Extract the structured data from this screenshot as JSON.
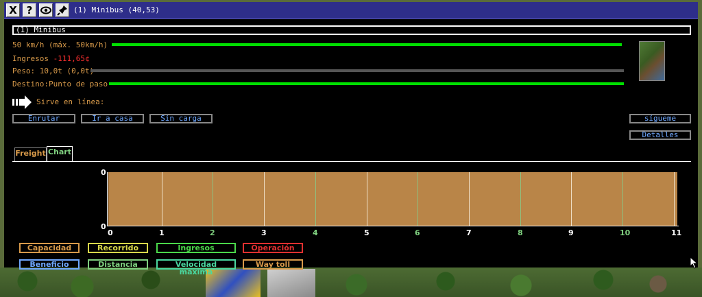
{
  "window": {
    "title": "(1) Minibus (40,53)",
    "buttons": [
      "X",
      "?",
      "👁",
      "📌"
    ],
    "vehicle_name": "(1) Minibus"
  },
  "info": {
    "speed": "50 km/h (máx. 50km/h)",
    "income_label": "Ingresos",
    "income_value": "-111,65¢",
    "weight": "Peso: 10,0t (0,0t)",
    "destination": "Destino:Punto de paso",
    "serves_line": "Sirve en línea:"
  },
  "buttons": {
    "route": "Enrutar",
    "home": "Ir a casa",
    "no_load": "Sin carga",
    "follow": "sígueme",
    "details": "Detalles"
  },
  "tabs": {
    "freight": "Freight",
    "chart": "Chart"
  },
  "chart_data": {
    "type": "line",
    "x": [
      0,
      1,
      2,
      3,
      4,
      5,
      6,
      7,
      8,
      9,
      10,
      11
    ],
    "ylim": [
      0,
      0
    ],
    "y_tick_labels": [
      "0",
      "0"
    ],
    "x_tick_colors": [
      "#ffffff",
      "#ffffff",
      "#7fd07f",
      "#ffffff",
      "#7fd07f",
      "#ffffff",
      "#7fd07f",
      "#ffffff",
      "#7fd07f",
      "#ffffff",
      "#7fd07f",
      "#ffffff"
    ],
    "series": [
      {
        "name": "Capacidad",
        "color": "#d89a4a",
        "values": [
          0,
          0,
          0,
          0,
          0,
          0,
          0,
          0,
          0,
          0,
          0,
          0
        ]
      },
      {
        "name": "Recorrido",
        "color": "#d8d84a",
        "values": [
          0,
          0,
          0,
          0,
          0,
          0,
          0,
          0,
          0,
          0,
          0,
          0
        ]
      },
      {
        "name": "Ingresos",
        "color": "#4ad84a",
        "values": [
          0,
          0,
          0,
          0,
          0,
          0,
          0,
          0,
          0,
          0,
          0,
          0
        ]
      },
      {
        "name": "Operación",
        "color": "#e03030",
        "values": [
          0,
          0,
          0,
          0,
          0,
          0,
          0,
          0,
          0,
          0,
          0,
          0
        ]
      },
      {
        "name": "Beneficio",
        "color": "#6fa8ff",
        "values": [
          0,
          0,
          0,
          0,
          0,
          0,
          0,
          0,
          0,
          0,
          0,
          0
        ]
      },
      {
        "name": "Distancia",
        "color": "#7fd07f",
        "values": [
          0,
          0,
          0,
          0,
          0,
          0,
          0,
          0,
          0,
          0,
          0,
          0
        ]
      },
      {
        "name": "Velocidad máxima",
        "color": "#4ad8a0",
        "values": [
          0,
          0,
          0,
          0,
          0,
          0,
          0,
          0,
          0,
          0,
          0,
          0
        ]
      },
      {
        "name": "Way toll",
        "color": "#d89a4a",
        "values": [
          0,
          0,
          0,
          0,
          0,
          0,
          0,
          0,
          0,
          0,
          0,
          0
        ]
      }
    ]
  },
  "progress": {
    "speed": 1.0,
    "weight": 0.0,
    "destination": 1.0
  }
}
